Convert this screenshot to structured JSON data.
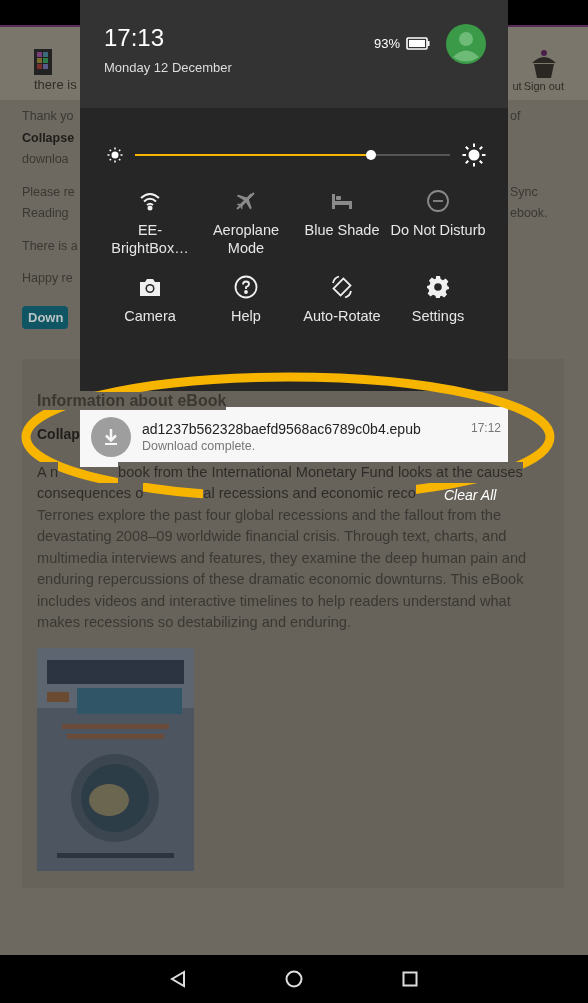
{
  "background_page": {
    "header": {
      "logo_label": "there is",
      "partial_link": "ut",
      "sign_out": "Sign out"
    },
    "paragraphs": [
      {
        "lines": [
          {
            "left": "Thank yo",
            "right": "of",
            "bold": false
          },
          {
            "left": "Collapse",
            "bold": true
          },
          {
            "left": "downloa",
            "bold": false
          }
        ]
      },
      {
        "lines": [
          {
            "left": "Please re",
            "right": "Sync",
            "bold": false
          },
          {
            "left": "Reading",
            "right": "ebook.",
            "bold": false
          }
        ]
      },
      {
        "lines": [
          {
            "left": "There is a",
            "bold": false
          }
        ]
      },
      {
        "lines": [
          {
            "left": "Happy re",
            "bold": false
          }
        ]
      }
    ],
    "download_button": "Down",
    "info_card": {
      "heading": "Information about eBook",
      "title": "Collap",
      "partial_lines": [
        [
          "A n",
          "book from the International Monetary Fund looks at the causes"
        ],
        [
          "consequences o",
          "al recessions and economic reco"
        ]
      ],
      "paragraph": "Terrones explore the past four global recessions and the fallout from the devastating 2008–09 worldwide financial crisis. Through text, charts, and multimedia interviews and features, they examine the deep human pain and enduring repercussions of these dramatic economic downturns. This eBook includes videos and interactive timelines to help readers understand what makes recessions so destabilizing and enduring.",
      "cover": {
        "kind": "picture"
      }
    }
  },
  "quick_settings": {
    "time": "17:13",
    "date": "Monday 12 December",
    "battery": "93%",
    "brightness": {
      "level": 0.75
    },
    "toggles": [
      {
        "kind": "wifi",
        "label": "EE-BrightBox…",
        "on": true
      },
      {
        "kind": "aeroplane",
        "label": "Aeroplane Mode",
        "on": false
      },
      {
        "kind": "blue_shade",
        "label": "Blue Shade",
        "on": false
      },
      {
        "kind": "do_not_disturb",
        "label": "Do Not Disturb",
        "on": false
      },
      {
        "kind": "camera",
        "label": "Camera",
        "on": true
      },
      {
        "kind": "help",
        "label": "Help",
        "on": true
      },
      {
        "kind": "rotate",
        "label": "Auto-Rotate",
        "on": true
      },
      {
        "kind": "settings",
        "label": "Settings",
        "on": true
      }
    ]
  },
  "notification": {
    "title": "ad1237b562328baefd9568ac6789c0b4.epub",
    "message": "Download complete.",
    "time": "17:12"
  },
  "clear_all": "Clear All"
}
